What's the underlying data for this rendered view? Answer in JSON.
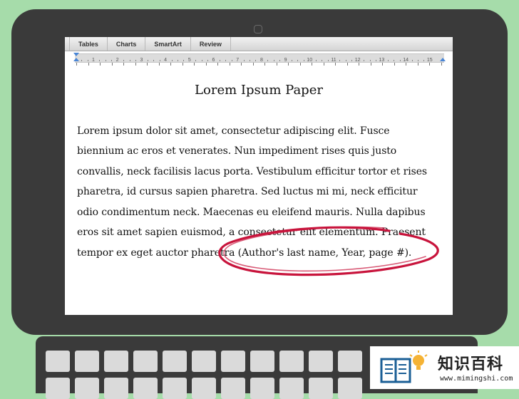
{
  "ribbon": {
    "tabs": [
      "Tables",
      "Charts",
      "SmartArt",
      "Review"
    ]
  },
  "ruler": {
    "numbers": [
      "1",
      "2",
      "3",
      "4",
      "5",
      "6",
      "7",
      "8",
      "9",
      "10",
      "11",
      "12",
      "13",
      "14",
      "15"
    ]
  },
  "document": {
    "title": "Lorem Ipsum Paper",
    "lines": [
      "Lorem ipsum dolor sit amet, consectetur adipiscing elit. Fusce",
      "biennium ac eros et venerates. Nun impediment rises quis justo",
      "convallis, neck facilisis lacus porta. Vestibulum efficitur tortor et rises",
      "pharetra, id cursus sapien pharetra. Sed luctus mi mi, neck efficitur",
      "odio condimentum neck. Maecenas eu eleifend mauris. Nulla dapibus",
      "eros sit amet sapien euismod, a consectetur elit elementum. Praesent",
      "tempor ex eget auctor pharetra (Author's last name, Year, page #)."
    ],
    "annotation_color": "#c8143c"
  },
  "watermark": {
    "text": "知识百科",
    "url": "www.mimingshi.com"
  }
}
